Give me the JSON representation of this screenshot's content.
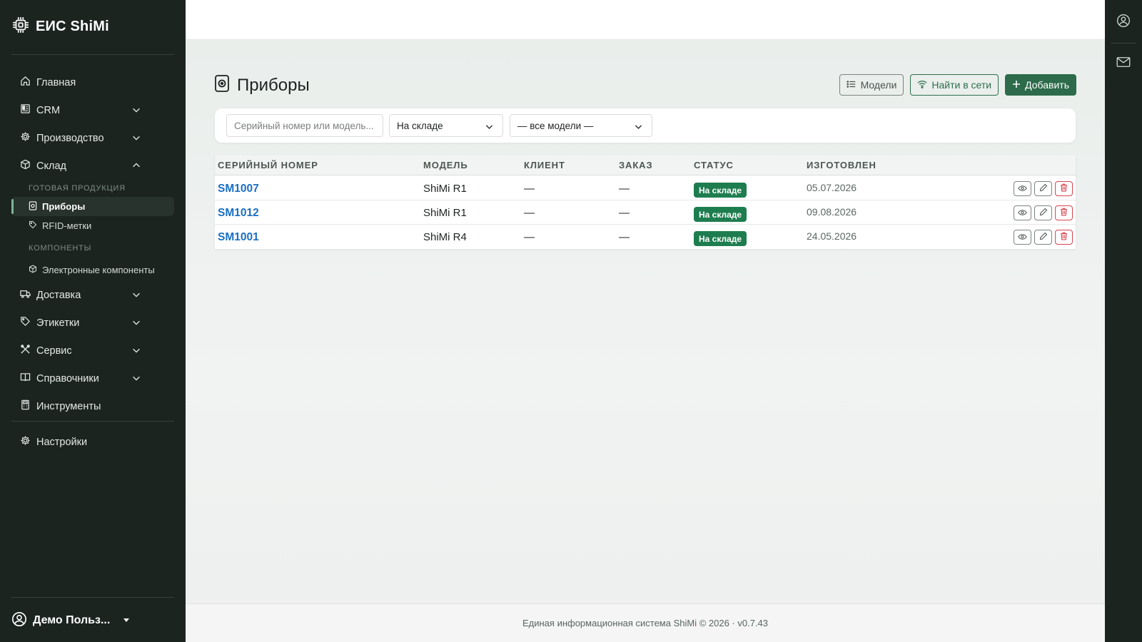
{
  "app": {
    "brand": "ЕИС ShiMi"
  },
  "sidebar": {
    "nav": [
      {
        "label": "Главная",
        "icon": "home-icon",
        "expandable": false
      },
      {
        "label": "CRM",
        "icon": "crm-icon",
        "expandable": true,
        "expanded": false
      },
      {
        "label": "Производство",
        "icon": "gear-icon",
        "expandable": true,
        "expanded": false
      },
      {
        "label": "Склад",
        "icon": "box-icon",
        "expandable": true,
        "expanded": true
      }
    ],
    "warehouse": {
      "section_finished": "ГОТОВАЯ ПРОДУКЦИЯ",
      "item_devices": "Приборы",
      "item_rfid": "RFID-метки",
      "section_components": "КОМПОНЕНТЫ",
      "item_electronics": "Электронные компоненты"
    },
    "nav_after": [
      {
        "label": "Доставка",
        "icon": "truck-icon",
        "expandable": true
      },
      {
        "label": "Этикетки",
        "icon": "tag-icon",
        "expandable": true
      },
      {
        "label": "Сервис",
        "icon": "tools-icon",
        "expandable": true
      },
      {
        "label": "Справочники",
        "icon": "book-icon",
        "expandable": true
      },
      {
        "label": "Инструменты",
        "icon": "calculator-icon",
        "expandable": false
      }
    ],
    "settings_label": "Настройки",
    "user_name": "Демо Польз..."
  },
  "page": {
    "title": "Приборы",
    "actions": {
      "models": "Модели",
      "find_network": "Найти в сети",
      "add": "Добавить"
    },
    "filters": {
      "search_placeholder": "Серийный номер или модель...",
      "status_value": "На складе",
      "model_value": "— все модели —"
    },
    "table": {
      "columns": [
        "СЕРИЙНЫЙ НОМЕР",
        "МОДЕЛЬ",
        "КЛИЕНТ",
        "ЗАКАЗ",
        "СТАТУС",
        "ИЗГОТОВЛЕН"
      ],
      "rows": [
        {
          "serial": "SM1007",
          "model": "ShiMi R1",
          "client": "—",
          "order": "—",
          "status": "На складе",
          "made": "05.07.2026"
        },
        {
          "serial": "SM1012",
          "model": "ShiMi R1",
          "client": "—",
          "order": "—",
          "status": "На складе",
          "made": "09.08.2026"
        },
        {
          "serial": "SM1001",
          "model": "ShiMi R4",
          "client": "—",
          "order": "—",
          "status": "На складе",
          "made": "24.05.2026"
        }
      ]
    }
  },
  "footer": {
    "text": "Единая информационная система ShiMi © 2026 · v0.7.43"
  },
  "colors": {
    "sidebar_bg": "#1c2420",
    "accent_green": "#2d6b4b",
    "status_green": "#1e7d4f",
    "link_blue": "#1a6fc2",
    "danger_red": "#d9434f"
  }
}
